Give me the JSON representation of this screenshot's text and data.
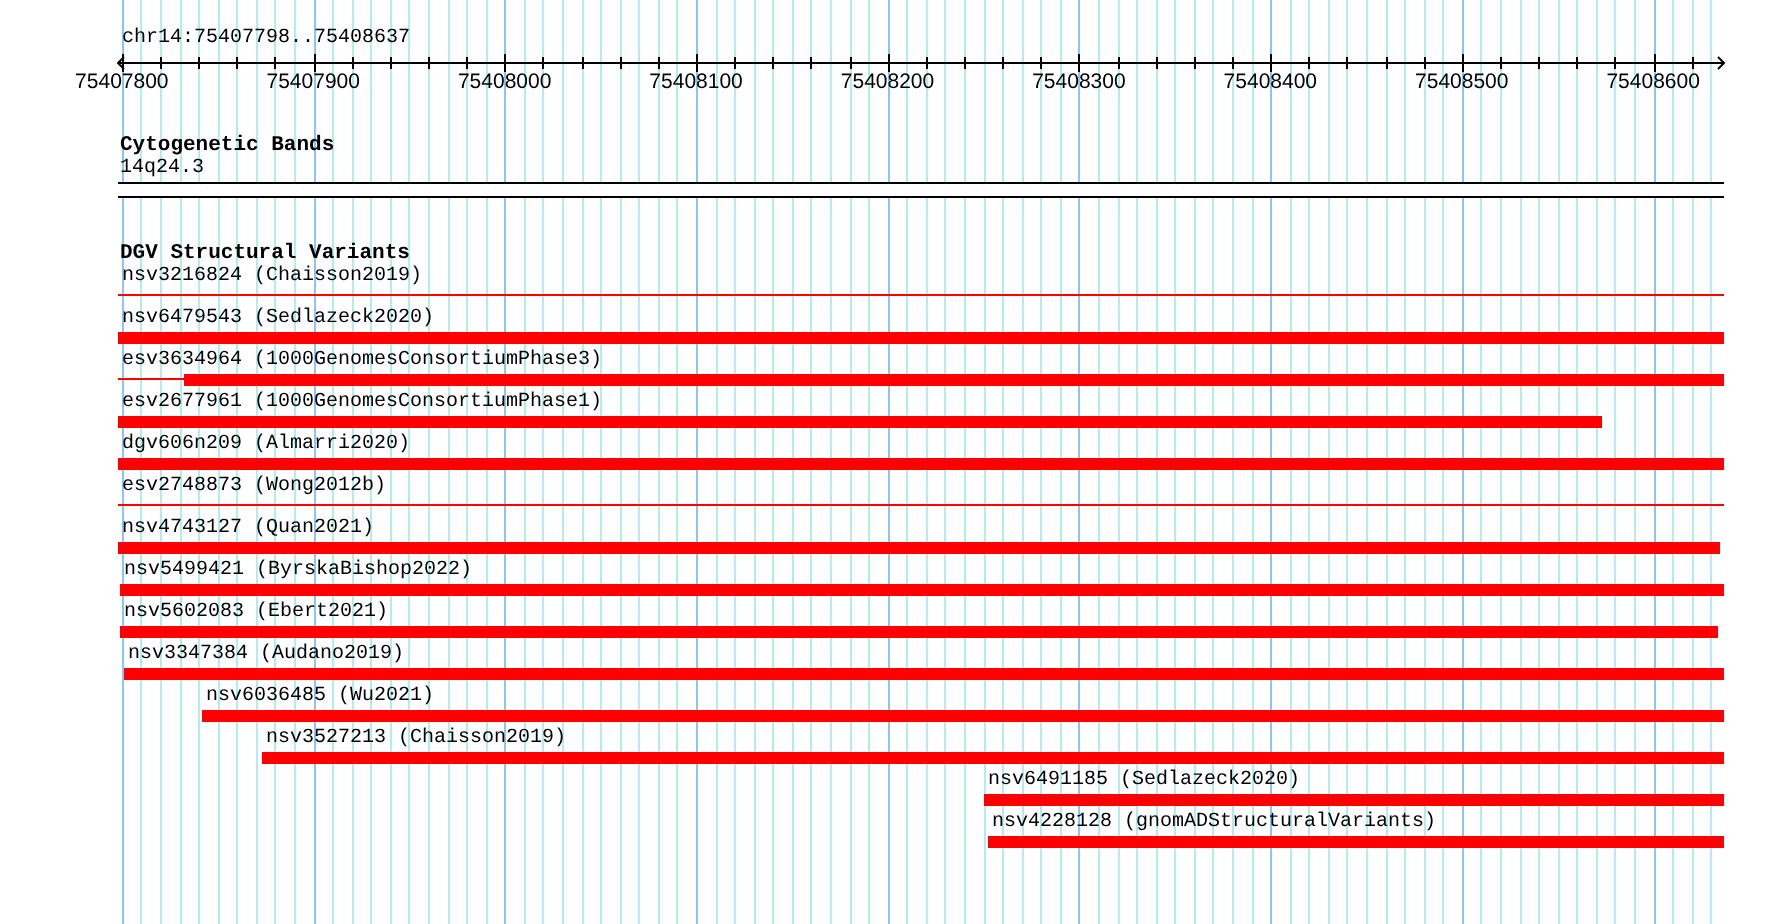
{
  "ruler": {
    "location": "chr14:75407798..75408637",
    "ticks": [
      "75407800",
      "75407900",
      "75408000",
      "75408100",
      "75408200",
      "75408300",
      "75408400",
      "75408500",
      "75408600"
    ]
  },
  "tracks": [
    {
      "kind": "bands",
      "title": "Cytogenetic Bands",
      "bands": [
        {
          "name": "14q24.3"
        }
      ]
    },
    {
      "kind": "variants",
      "title": "DGV Structural Variants",
      "features": [
        {
          "label": "nsv3216824 (Chaisson2019)",
          "kind": "thin"
        },
        {
          "label": "nsv6479543 (Sedlazeck2020)",
          "kind": "thick"
        },
        {
          "label": "esv3634964 (1000GenomesConsortiumPhase3)",
          "kind": "mixed"
        },
        {
          "label": "esv2677961 (1000GenomesConsortiumPhase1)",
          "kind": "thick"
        },
        {
          "label": "dgv606n209 (Almarri2020)",
          "kind": "thick"
        },
        {
          "label": "esv2748873 (Wong2012b)",
          "kind": "thin"
        },
        {
          "label": "nsv4743127 (Quan2021)",
          "kind": "thick"
        },
        {
          "label": "nsv5499421 (ByrskaBishop2022)",
          "kind": "thick"
        },
        {
          "label": "nsv5602083 (Ebert2021)",
          "kind": "thick"
        },
        {
          "label": "nsv3347384 (Audano2019)",
          "kind": "thick"
        },
        {
          "label": "nsv6036485 (Wu2021)",
          "kind": "thick"
        },
        {
          "label": "nsv3527213 (Chaisson2019)",
          "kind": "thick"
        },
        {
          "label": "nsv6491185 (Sedlazeck2020)",
          "kind": "thick"
        },
        {
          "label": "nsv4228128 (gnomADStructuralVariants)",
          "kind": "thick"
        }
      ]
    }
  ]
}
